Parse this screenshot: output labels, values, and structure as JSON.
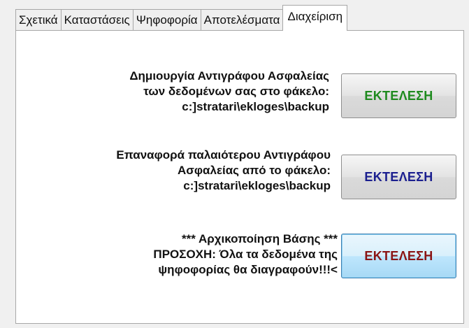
{
  "tabs": [
    {
      "label": "Σχετικά"
    },
    {
      "label": "Καταστάσεις"
    },
    {
      "label": "Ψηφοφορία"
    },
    {
      "label": "Αποτελέσματα"
    },
    {
      "label": "Διαχείριση"
    }
  ],
  "active_tab": "Διαχείριση",
  "actions": [
    {
      "lines": [
        "Δημιουργία Αντιγράφου Ασφαλείας",
        "των δεδομένων σας στο φάκελο:",
        "c:]stratari\\ekloges\\backup"
      ],
      "button_label": "ΕΚΤΕΛΕΣΗ",
      "button_color": "#1e8a1e"
    },
    {
      "lines": [
        "Επαναφορά παλαιότερου Αντιγράφου",
        "Ασφαλείας από το φάκελο:",
        "c:]stratari\\ekloges\\backup"
      ],
      "button_label": "ΕΚΤΕΛΕΣΗ",
      "button_color": "#1b1f8f"
    },
    {
      "lines": [
        "*** Αρχικοποίηση Βάσης ***",
        "ΠΡΟΣΟΧΗ: Όλα τα δεδομένα της",
        "ψηφοφορίας θα διαγραφούν!!!<"
      ],
      "button_label": "ΕΚΤΕΛΕΣΗ",
      "button_color": "#8a1414"
    }
  ]
}
